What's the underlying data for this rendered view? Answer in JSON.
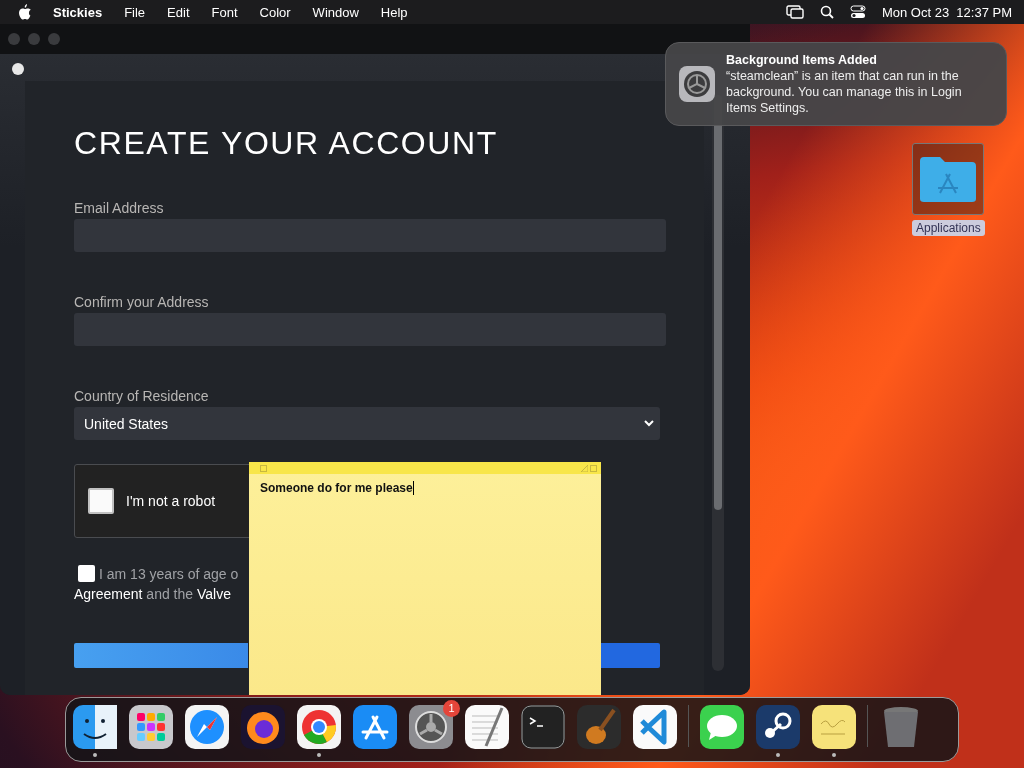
{
  "menu_bar": {
    "app_name": "Stickies",
    "menus": [
      "File",
      "Edit",
      "Font",
      "Color",
      "Window",
      "Help"
    ],
    "clock": "Mon Oct 23  12:37 PM"
  },
  "signup_window": {
    "heading": "CREATE YOUR ACCOUNT",
    "fields": [
      {
        "kind": "text",
        "label": "Email Address"
      },
      {
        "kind": "text",
        "label": "Confirm your Address"
      },
      {
        "kind": "select",
        "label": "Country of Residence",
        "value": "United States"
      }
    ],
    "captcha": {
      "label": "I'm not a robot",
      "checked": false
    },
    "age_check": {
      "checked": false,
      "line_1": "I am 13 years of age o",
      "line_2": "**Agreement** and the **Valve**"
    }
  },
  "sticky_note": {
    "text": "Someone do for me please"
  },
  "notification": {
    "title": "Background Items Added",
    "body": "“steamclean” is an item that can run in the background. You can manage this in Login Items Settings."
  },
  "desktop_icons": [
    {
      "label": "Applications"
    }
  ],
  "dock": {
    "items": [
      {
        "kind": "finder",
        "running": true
      },
      {
        "kind": "launchpad",
        "running": false
      },
      {
        "kind": "safari",
        "running": false
      },
      {
        "kind": "firefox",
        "running": false
      },
      {
        "kind": "chrome",
        "running": true
      },
      {
        "kind": "appstore",
        "running": false
      },
      {
        "kind": "settings",
        "running": false,
        "badge": "1"
      },
      {
        "kind": "textedit",
        "running": false
      },
      {
        "kind": "terminal",
        "running": false
      },
      {
        "kind": "garageband",
        "running": false
      },
      {
        "kind": "vscode",
        "running": false
      },
      {
        "kind": "separator"
      },
      {
        "kind": "messages",
        "running": false
      },
      {
        "kind": "steam",
        "running": true
      },
      {
        "kind": "stickies",
        "running": true
      },
      {
        "kind": "separator"
      },
      {
        "kind": "trash",
        "running": false
      }
    ]
  }
}
